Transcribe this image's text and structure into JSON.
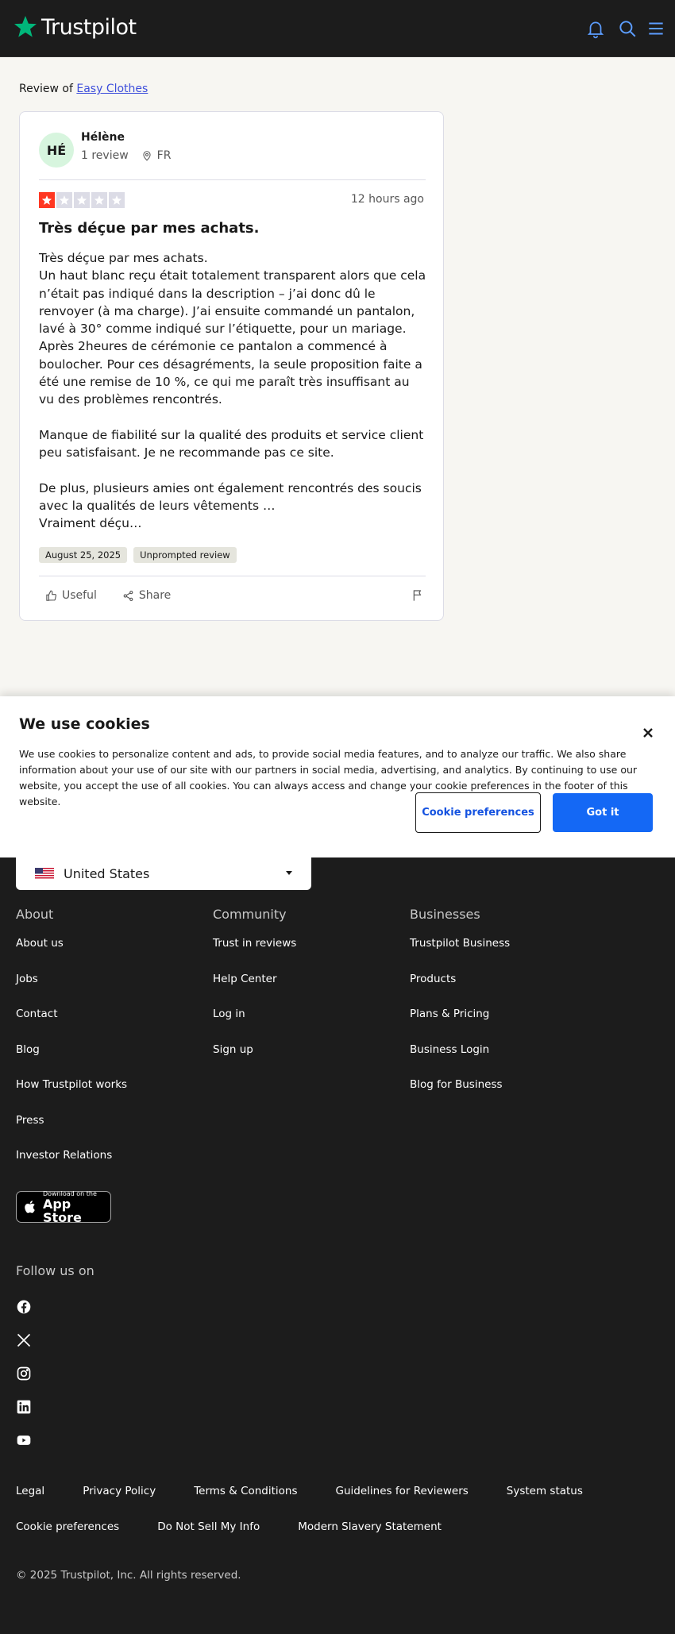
{
  "header": {
    "logo_text": "Trustpilot",
    "icons": [
      "bell-icon",
      "search-icon",
      "menu-icon"
    ],
    "accent_color": "#00b67a"
  },
  "review_of": {
    "prefix": "Review of",
    "company": "Easy Clothes"
  },
  "review": {
    "avatar_initials": "HÉ",
    "reviewer_name": "Hélène",
    "review_count": "1 review",
    "country": "FR",
    "rating": 1,
    "rating_max": 5,
    "time_ago": "12 hours ago",
    "title": "Très déçue par mes achats.",
    "body": "Très déçue par mes achats.\nUn haut blanc reçu était totalement transparent alors que cela n’était pas indiqué dans la description – j’ai donc dû le renvoyer (à ma charge). J’ai ensuite commandé un pantalon, lavé à 30° comme indiqué sur l’étiquette, pour un mariage. Après 2heures de cérémonie ce pantalon a commencé à boulocher. Pour ces désagréments, la seule proposition faite a été une remise de 10 %, ce qui me paraît très insuffisant au vu des problèmes rencontrés.\n\nManque de fiabilité sur la qualité des produits et service client peu satisfaisant. Je ne recommande pas ce site.\n\nDe plus, plusieurs amies ont également rencontrés des soucis avec la qualités de leurs vêtements …\nVraiment déçu…",
    "date_tag": "August 25, 2025",
    "type_tag": "Unprompted review",
    "useful_label": "Useful",
    "share_label": "Share",
    "star_color": "#ff3722"
  },
  "cookie_banner": {
    "title": "We use cookies",
    "text": "We use cookies to personalize content and ads, to provide social media features, and to analyze our traffic. We also share information about your use of our site with our partners in social media, advertising, and analytics. By continuing to use our website, you accept the use of all cookies. You can always access and change your cookie preferences in the footer of this website.",
    "preferences_label": "Cookie preferences",
    "accept_label": "Got it",
    "accept_color": "#1468f5"
  },
  "footer": {
    "country_selected": "United States",
    "columns": [
      {
        "title": "About",
        "links": [
          "About us",
          "Jobs",
          "Contact",
          "Blog",
          "How Trustpilot works",
          "Press",
          "Investor Relations"
        ]
      },
      {
        "title": "Community",
        "links": [
          "Trust in reviews",
          "Help Center",
          "Log in",
          "Sign up"
        ]
      },
      {
        "title": "Businesses",
        "links": [
          "Trustpilot Business",
          "Products",
          "Plans & Pricing",
          "Business Login",
          "Blog for Business"
        ]
      }
    ],
    "app_store_small": "Download on the",
    "app_store_big": "App Store",
    "follow_title": "Follow us on",
    "social_icons": [
      "facebook-icon",
      "x-icon",
      "instagram-icon",
      "linkedin-icon",
      "youtube-icon"
    ],
    "legal_row_1": [
      "Legal",
      "Privacy Policy",
      "Terms & Conditions",
      "Guidelines for Reviewers",
      "System status"
    ],
    "legal_row_2": [
      "Cookie preferences",
      "Do Not Sell My Info",
      "Modern Slavery Statement"
    ],
    "copyright": "© 2025 Trustpilot, Inc. All rights reserved."
  }
}
